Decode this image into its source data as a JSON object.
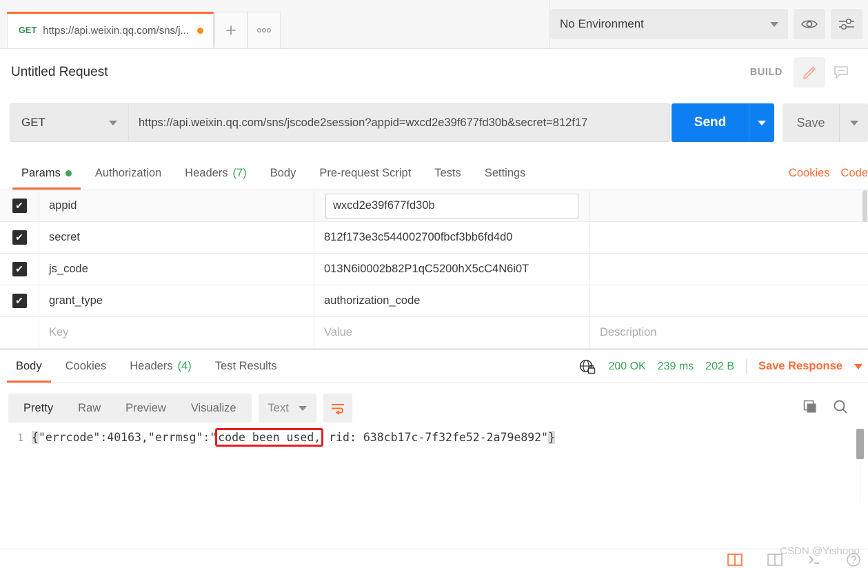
{
  "tabbar": {
    "request_tab": {
      "method": "GET",
      "url_label": "https://api.weixin.qq.com/sns/j...",
      "unsaved_icon": "orange-dot"
    },
    "new_tab_label": "+",
    "more_tabs_label": "ooo",
    "environment": {
      "selected": "No Environment",
      "eye_icon": "eye-icon",
      "settings_icon": "sliders-icon"
    }
  },
  "request": {
    "title": "Untitled Request",
    "build_label": "BUILD",
    "edit_icon": "pencil-icon",
    "comment_icon": "comment-icon",
    "method": "GET",
    "url": "https://api.weixin.qq.com/sns/jscode2session?appid=wxcd2e39f677fd30b&secret=812f17",
    "send_label": "Send",
    "save_label": "Save"
  },
  "request_tabs": {
    "items": [
      {
        "label": "Params",
        "badge": "",
        "dot": true,
        "active": true
      },
      {
        "label": "Authorization",
        "badge": "",
        "dot": false,
        "active": false
      },
      {
        "label": "Headers",
        "badge": "(7)",
        "dot": false,
        "active": false
      },
      {
        "label": "Body",
        "badge": "",
        "dot": false,
        "active": false
      },
      {
        "label": "Pre-request Script",
        "badge": "",
        "dot": false,
        "active": false
      },
      {
        "label": "Tests",
        "badge": "",
        "dot": false,
        "active": false
      },
      {
        "label": "Settings",
        "badge": "",
        "dot": false,
        "active": false
      }
    ],
    "cookies_link": "Cookies",
    "code_link": "Code"
  },
  "params_table": {
    "columns": [
      "Key",
      "Value",
      "Description"
    ],
    "rows": [
      {
        "checked": true,
        "key": "appid",
        "value": "wxcd2e39f677fd30b",
        "description": "",
        "editing": true
      },
      {
        "checked": true,
        "key": "secret",
        "value": "812f173e3c544002700fbcf3bb6fd4d0",
        "description": "",
        "editing": false
      },
      {
        "checked": true,
        "key": "js_code",
        "value": "013N6i0002b82P1qC5200hX5cC4N6i0T",
        "description": "",
        "editing": false
      },
      {
        "checked": true,
        "key": "grant_type",
        "value": "authorization_code",
        "description": "",
        "editing": false
      }
    ],
    "placeholder_row": {
      "key": "Key",
      "value": "Value",
      "description": "Description"
    }
  },
  "response": {
    "tabs": [
      {
        "label": "Body",
        "badge": "",
        "active": true
      },
      {
        "label": "Cookies",
        "badge": "",
        "active": false
      },
      {
        "label": "Headers",
        "badge": "(4)",
        "active": false
      },
      {
        "label": "Test Results",
        "badge": "",
        "active": false
      }
    ],
    "globe_icon": "globe-lock-icon",
    "status": "200 OK",
    "time": "239 ms",
    "size": "202 B",
    "save_response_label": "Save Response",
    "view_modes": [
      {
        "label": "Pretty",
        "active": true
      },
      {
        "label": "Raw",
        "active": false
      },
      {
        "label": "Preview",
        "active": false
      },
      {
        "label": "Visualize",
        "active": false
      }
    ],
    "format": "Text",
    "wrap_icon": "word-wrap-icon",
    "copy_icon": "copy-icon",
    "search_icon": "search-icon",
    "body": {
      "line_number": "1",
      "prefix": "{\"errcode\":40163,\"errmsg\":\"",
      "highlighted": "code been used,",
      "suffix": " rid: 638cb17c-7f32fe52-2a79e892\"}",
      "open_brace": "{",
      "close_brace": "}"
    }
  },
  "footer": {
    "watermark": "CSDN @Yishooo."
  },
  "colors": {
    "accent": "#ff6c37",
    "send_blue": "#0d7ff2",
    "status_green": "#3aa757",
    "highlight_red": "#e81f1f"
  }
}
